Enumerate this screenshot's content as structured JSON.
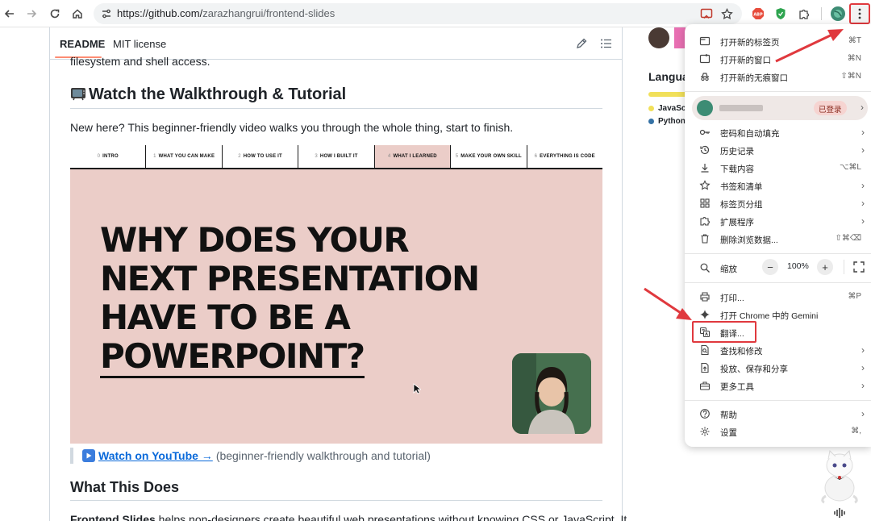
{
  "browser": {
    "url_host": "https://github.com/",
    "url_path": "zarazhangrui/frontend-slides"
  },
  "readme_tabs": {
    "readme": "README",
    "license": "MIT license"
  },
  "content": {
    "cut_off_line": "filesystem and shell access.",
    "walkthrough_heading": "Watch the Walkthrough & Tutorial",
    "intro_paragraph": "New here? This beginner-friendly video walks you through the whole thing, start to finish.",
    "youtube_link": "Watch on YouTube →",
    "youtube_note": "(beginner-friendly walkthrough and tutorial)",
    "what_heading": "What This Does",
    "cut_paragraph_bold": "Frontend Slides",
    "cut_paragraph_rest": " helps non-designers create beautiful web presentations without knowing CSS or JavaScript. It"
  },
  "video": {
    "chapters": [
      {
        "num": "0",
        "label": "INTRO"
      },
      {
        "num": "1",
        "label": "WHAT YOU CAN MAKE"
      },
      {
        "num": "2",
        "label": "HOW TO USE IT"
      },
      {
        "num": "3",
        "label": "HOW I BUILT IT"
      },
      {
        "num": "4",
        "label": "WHAT I LEARNED"
      },
      {
        "num": "5",
        "label": "MAKE YOUR OWN SKILL"
      },
      {
        "num": "6",
        "label": "EVERYTHING IS CODE"
      }
    ],
    "active_chapter_index": 4,
    "headline_line1": "WHY DOES YOUR",
    "headline_line2": "NEXT PRESENTATION",
    "headline_line3": "HAVE TO BE A",
    "headline_line4": "POWERPOINT?"
  },
  "sidebar": {
    "languages_heading": "Langua",
    "lang_items": [
      {
        "name": "JavaSc",
        "color": "#f1e05a"
      },
      {
        "name": "Python",
        "color": "#3572a5"
      }
    ]
  },
  "menu": {
    "new_tab": {
      "label": "打开新的标签页",
      "shortcut": "⌘T"
    },
    "new_window": {
      "label": "打开新的窗口",
      "shortcut": "⌘N"
    },
    "incognito": {
      "label": "打开新的无痕窗口",
      "shortcut": "⇧⌘N"
    },
    "profile_status": "已登录",
    "passwords": {
      "label": "密码和自动填充"
    },
    "history": {
      "label": "历史记录"
    },
    "downloads": {
      "label": "下载内容",
      "shortcut": "⌥⌘L"
    },
    "bookmarks": {
      "label": "书签和清单"
    },
    "tab_groups": {
      "label": "标签页分组"
    },
    "extensions": {
      "label": "扩展程序"
    },
    "clear_data": {
      "label": "删除浏览数据...",
      "shortcut": "⇧⌘⌫"
    },
    "zoom": {
      "label": "缩放",
      "minus": "−",
      "value": "100%",
      "plus": "+"
    },
    "print": {
      "label": "打印...",
      "shortcut": "⌘P"
    },
    "gemini": {
      "label": "打开 Chrome 中的 Gemini"
    },
    "translate": {
      "label": "翻译..."
    },
    "find_edit": {
      "label": "查找和修改"
    },
    "cast_save": {
      "label": "投放、保存和分享"
    },
    "more_tools": {
      "label": "更多工具"
    },
    "help": {
      "label": "帮助"
    },
    "settings": {
      "label": "设置",
      "shortcut": "⌘,"
    }
  },
  "colors": {
    "annotation_red": "#e0393e",
    "link_blue": "#0969da",
    "thumb_pink": "#ebcdc8"
  }
}
